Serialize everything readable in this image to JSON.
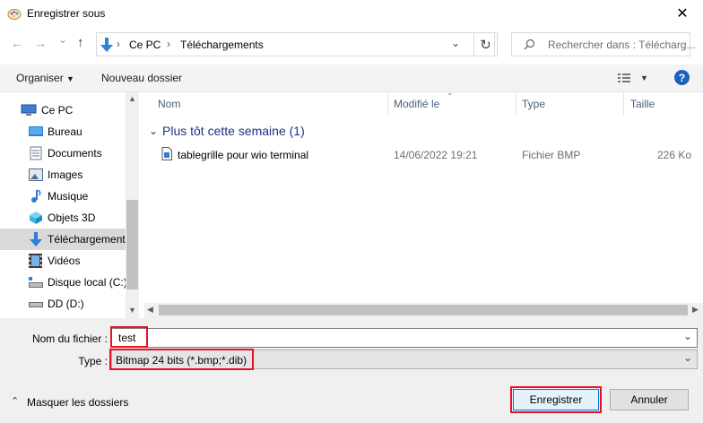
{
  "window": {
    "title": "Enregistrer sous",
    "close_glyph": "✕"
  },
  "nav": {
    "back_glyph": "←",
    "forward_glyph": "→",
    "recent_glyph": "⌄",
    "up_glyph": "↑",
    "breadcrumb": [
      "Ce PC",
      "Téléchargements"
    ],
    "refresh_glyph": "↻",
    "search_placeholder": "Rechercher dans : Télécharg..."
  },
  "toolbar": {
    "organize_label": "Organiser",
    "new_folder_label": "Nouveau dossier",
    "help_glyph": "?"
  },
  "sidebar": {
    "items": [
      {
        "label": "Ce PC",
        "icon": "pc-icon",
        "color": "#3a7dd1"
      },
      {
        "label": "Bureau",
        "icon": "desktop-icon",
        "color": "#2d7fd8"
      },
      {
        "label": "Documents",
        "icon": "documents-icon",
        "color": "#6b7a8f"
      },
      {
        "label": "Images",
        "icon": "pictures-icon",
        "color": "#4e6e8e"
      },
      {
        "label": "Musique",
        "icon": "music-icon",
        "color": "#2f7ad6"
      },
      {
        "label": "Objets 3D",
        "icon": "objects-3d-icon",
        "color": "#3ab4e6"
      },
      {
        "label": "Téléchargements",
        "icon": "downloads-icon",
        "color": "#2d7fd8"
      },
      {
        "label": "Vidéos",
        "icon": "videos-icon",
        "color": "#3a3a3a"
      },
      {
        "label": "Disque local (C:)",
        "icon": "drive-c-icon",
        "color": "#6a6a6a"
      },
      {
        "label": "DD (D:)",
        "icon": "drive-d-icon",
        "color": "#6a6a6a"
      }
    ],
    "selected_index": 6
  },
  "filelist": {
    "columns": [
      "Nom",
      "Modifié le",
      "Type",
      "Taille"
    ],
    "group": "Plus tôt cette semaine (1)",
    "rows": [
      {
        "name": "tablegrille pour wio terminal",
        "modified": "14/06/2022 19:21",
        "type": "Fichier BMP",
        "size": "226 Ko"
      }
    ]
  },
  "form": {
    "filename_label": "Nom du fichier :",
    "filename_value": "test",
    "type_label": "Type :",
    "type_value": "Bitmap 24 bits (*.bmp;*.dib)"
  },
  "footer": {
    "hide_folders_label": "Masquer les dossiers",
    "save_label": "Enregistrer",
    "cancel_label": "Annuler"
  },
  "colors": {
    "accent": "#0078d7",
    "highlight": "#e81123",
    "group_text": "#1e3287"
  }
}
